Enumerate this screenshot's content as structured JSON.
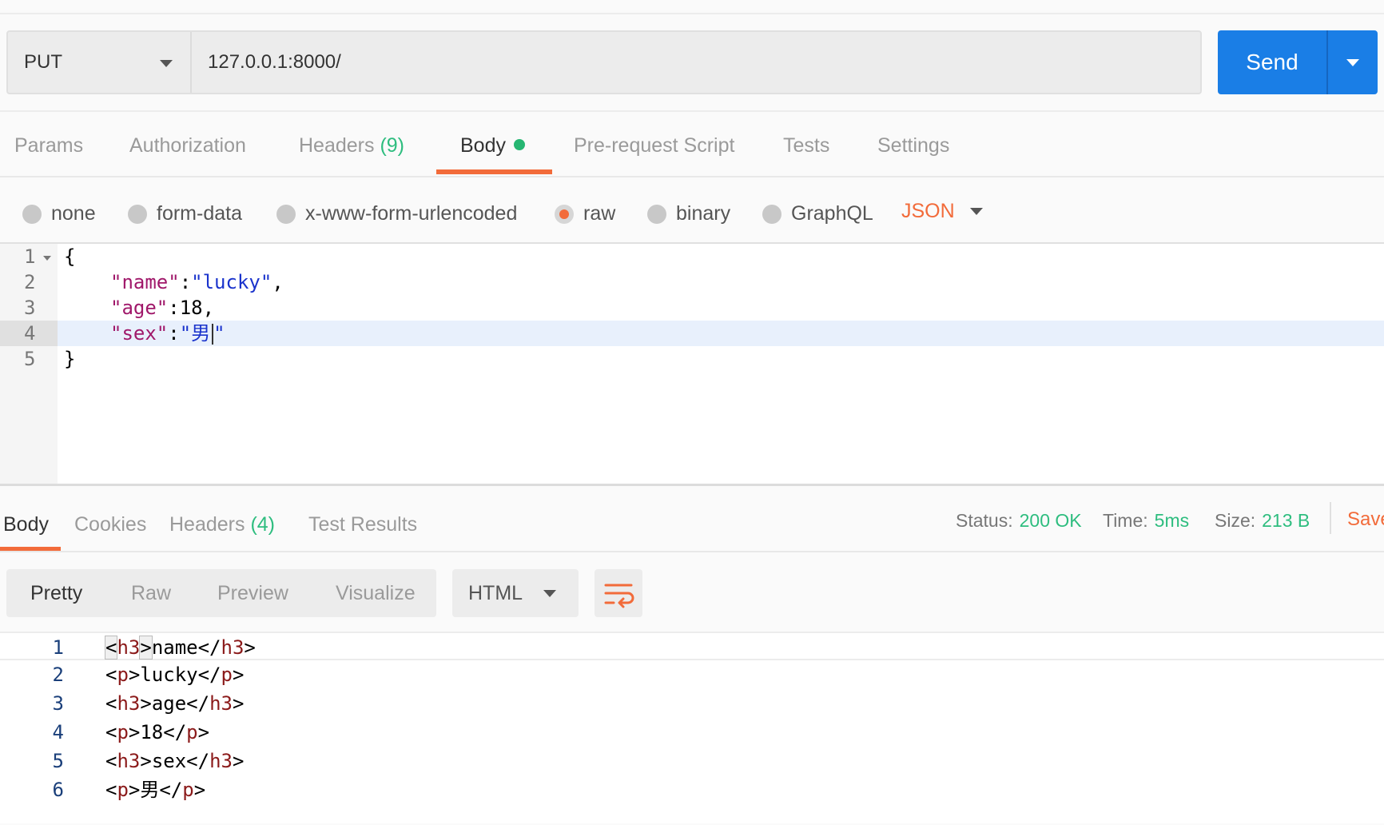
{
  "request": {
    "method": "PUT",
    "url": "127.0.0.1:8000/",
    "send_label": "Send"
  },
  "request_tabs": [
    {
      "label": "Params"
    },
    {
      "label": "Authorization"
    },
    {
      "label": "Headers",
      "count": "(9)"
    },
    {
      "label": "Body",
      "active": true,
      "indicator": "green-dot"
    },
    {
      "label": "Pre-request Script"
    },
    {
      "label": "Tests"
    },
    {
      "label": "Settings"
    }
  ],
  "body_types": [
    {
      "label": "none"
    },
    {
      "label": "form-data"
    },
    {
      "label": "x-www-form-urlencoded"
    },
    {
      "label": "raw",
      "selected": true
    },
    {
      "label": "binary"
    },
    {
      "label": "GraphQL"
    }
  ],
  "body_format": "JSON",
  "editor": {
    "line_numbers": [
      "1",
      "2",
      "3",
      "4",
      "5"
    ],
    "active_line": 4,
    "lines": {
      "l1": "{",
      "l2_key": "\"name\"",
      "l2_sep": ":",
      "l2_val": "\"lucky\"",
      "l2_end": ",",
      "l3_key": "\"age\"",
      "l3_sep": ":",
      "l3_val": "18",
      "l3_end": ",",
      "l4_key": "\"sex\"",
      "l4_sep": ":",
      "l4_val": "\"男",
      "l4_end": "\"",
      "l5": "}"
    }
  },
  "response_tabs": [
    {
      "label": "Body",
      "active": true
    },
    {
      "label": "Cookies"
    },
    {
      "label": "Headers",
      "count": "(4)"
    },
    {
      "label": "Test Results"
    }
  ],
  "response_meta": {
    "status_label": "Status:",
    "status_value": "200 OK",
    "time_label": "Time:",
    "time_value": "5ms",
    "size_label": "Size:",
    "size_value": "213 B",
    "save_label": "Save"
  },
  "view_modes": [
    {
      "label": "Pretty",
      "active": true
    },
    {
      "label": "Raw"
    },
    {
      "label": "Preview"
    },
    {
      "label": "Visualize"
    }
  ],
  "response_language": "HTML",
  "response_code": {
    "line_numbers": [
      "1",
      "2",
      "3",
      "4",
      "5",
      "6"
    ],
    "lines": [
      {
        "open": "h3",
        "text": "name"
      },
      {
        "open": "p",
        "text": "lucky"
      },
      {
        "open": "h3",
        "text": "age"
      },
      {
        "open": "p",
        "text": "18"
      },
      {
        "open": "h3",
        "text": "sex"
      },
      {
        "open": "p",
        "text": "男"
      }
    ]
  },
  "colors": {
    "accent": "#f26b3a",
    "send_button": "#1a7ee6",
    "success": "#2ebd7f"
  },
  "icons": {
    "method_dropdown": "chevron-down-icon",
    "send_dropdown": "chevron-down-icon",
    "wrap_lines": "wrap-lines-icon"
  }
}
